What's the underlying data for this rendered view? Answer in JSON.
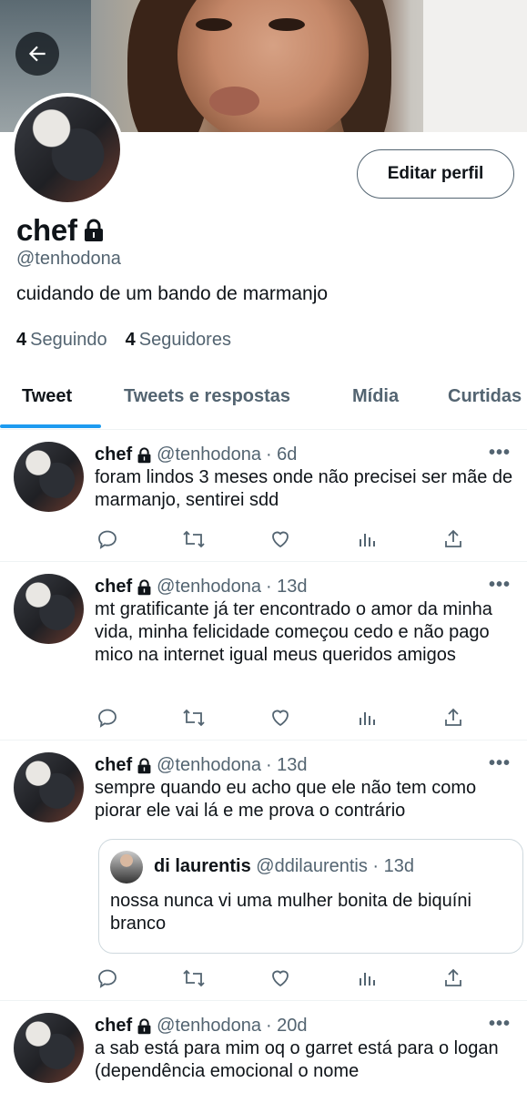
{
  "header": {
    "back_icon": "arrow-left-icon"
  },
  "profile": {
    "name": "chef",
    "handle": "@tenhodona",
    "bio": "cuidando de um bando de marmanjo",
    "edit_button": "Editar perfil",
    "following_count": "4",
    "following_label": "Seguindo",
    "followers_count": "4",
    "followers_label": "Seguidores",
    "protected_icon": "lock-icon"
  },
  "tabs": [
    {
      "label": "Tweet",
      "active": true
    },
    {
      "label": "Tweets e respostas",
      "active": false
    },
    {
      "label": "Mídia",
      "active": false
    },
    {
      "label": "Curtidas",
      "active": false
    }
  ],
  "colors": {
    "accent": "#1d9bf0",
    "text": "#0f1419",
    "secondary": "#536471"
  },
  "tweets": [
    {
      "name": "chef",
      "handle": "@tenhodona",
      "time": "· 6d",
      "text": "foram lindos 3 meses onde não precisei ser mãe de marmanjo, sentirei sdd"
    },
    {
      "name": "chef",
      "handle": "@tenhodona",
      "time": "· 13d",
      "text": "mt gratificante já ter encontrado o amor da minha vida, minha felicidade começou cedo e não pago mico na internet igual meus queridos amigos"
    },
    {
      "name": "chef",
      "handle": "@tenhodona",
      "time": "· 13d",
      "text": "sempre quando eu acho que ele não tem como piorar ele vai lá e me prova o contrário",
      "quote": {
        "name": "di laurentis",
        "handle": "@ddilaurentis",
        "time": "· 13d",
        "text": "nossa nunca vi uma mulher bonita de biquíni branco"
      }
    },
    {
      "name": "chef",
      "handle": "@tenhodona",
      "time": "· 20d",
      "text": "a sab está para mim oq o garret está para o logan (dependência emocional o nome"
    }
  ],
  "more_label": "•••"
}
